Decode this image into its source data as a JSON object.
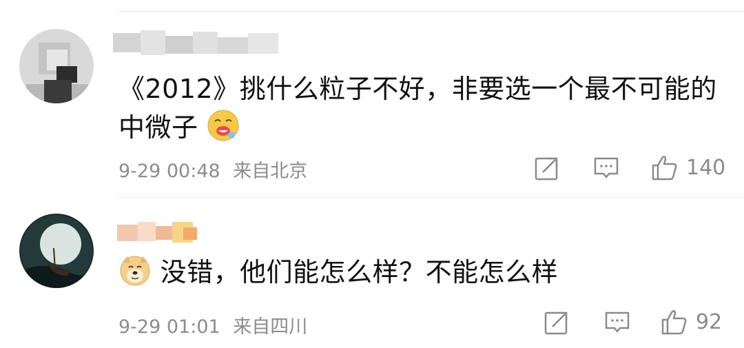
{
  "comments": [
    {
      "text_line1": "《2012》挑什么粒子不好，非要选一个最不可能的",
      "text_line2": "中微子",
      "emoji": "drooling-face-emoji",
      "time": "9-29 00:48",
      "location": "来自北京",
      "likes": "140"
    },
    {
      "text_prefix_emoji": "doge-emoji",
      "text_line1": "没错，他们能怎么样？不能怎么样",
      "time": "9-29 01:01",
      "location": "来自四川",
      "likes": "92"
    }
  ],
  "colors": {
    "meta_text": "#8c8c8c",
    "divider": "#ececec",
    "emoji_yellow": "#f7c948"
  }
}
